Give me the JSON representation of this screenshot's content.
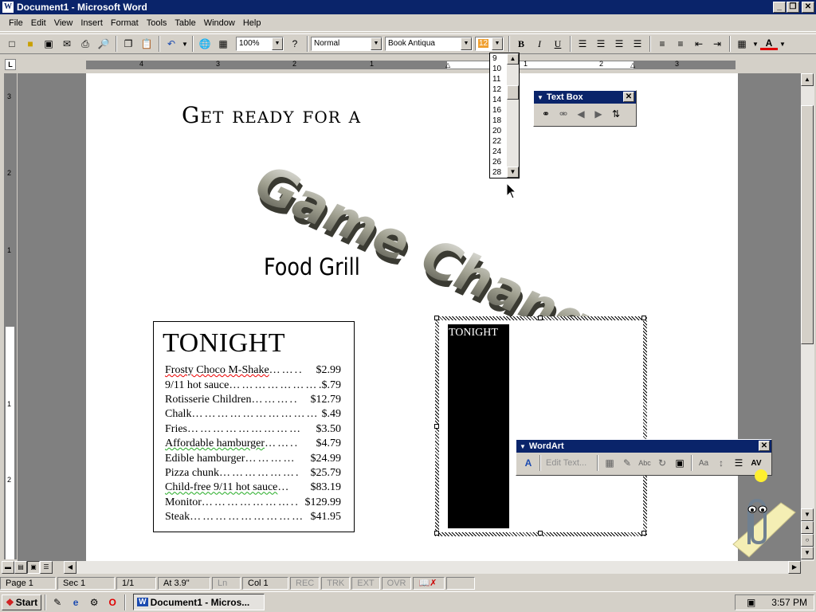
{
  "window": {
    "title": "Document1 - Microsoft Word",
    "app_icon": "W",
    "minimize": "_",
    "restore": "❐",
    "close": "✕"
  },
  "menu": [
    "File",
    "Edit",
    "View",
    "Insert",
    "Format",
    "Tools",
    "Table",
    "Window",
    "Help"
  ],
  "toolbar": {
    "zoom": "100%",
    "style": "Normal",
    "font": "Book Antiqua",
    "font_size": "12",
    "bold": "B",
    "italic": "I",
    "underline": "U",
    "font_color": "A"
  },
  "font_size_list": [
    "9",
    "10",
    "11",
    "12",
    "14",
    "16",
    "18",
    "20",
    "22",
    "24",
    "26",
    "28"
  ],
  "ruler_numbers": [
    "4",
    "3",
    "2",
    "1",
    "1",
    "2",
    "3"
  ],
  "vruler_numbers": [
    "3",
    "2",
    "1",
    "1",
    "2"
  ],
  "textbox_toolbar": {
    "title": "Text Box",
    "close": "✕"
  },
  "wordart_toolbar": {
    "title": "WordArt",
    "edit_text": "Edit Text...",
    "close": "✕",
    "spacing": "AV",
    "same_height": "Aa"
  },
  "document": {
    "heading": "Get ready for a",
    "wordart": "Game Changer!",
    "subtitle": "Food Grill",
    "menu_title": "TONIGHT",
    "items": [
      {
        "name": "Frosty Choco M-Shake",
        "dots": "……..",
        "price": "$2.99"
      },
      {
        "name": "9/11 hot sauce",
        "dots": "……………………",
        "price": "$.79"
      },
      {
        "name": "Rotisserie Children",
        "dots": "………..",
        "price": "$12.79"
      },
      {
        "name": "Chalk",
        "dots": "…………………………",
        "price": "$.49"
      },
      {
        "name": "Fries",
        "dots": "………………………",
        "price": "$3.50"
      },
      {
        "name": "Affordable hamburger",
        "dots": "……..",
        "price": "$4.79"
      },
      {
        "name": "Edible hamburger",
        "dots": "…………",
        "price": "$24.99"
      },
      {
        "name": "Pizza chunk",
        "dots": "……………….",
        "price": "$25.79"
      },
      {
        "name": "Child-free 9/11 hot sauce",
        "dots": "…",
        "price": "$83.19"
      },
      {
        "name": "Monitor",
        "dots": "…………………..",
        "price": "$129.99"
      },
      {
        "name": "Steak",
        "dots": "………………………",
        "price": "$41.95"
      }
    ],
    "textbox_label": "TONIGHT"
  },
  "status": {
    "page": "Page  1",
    "sec": "Sec  1",
    "pages": "1/1",
    "at": "At  3.9\"",
    "ln": "Ln",
    "col": "Col  1",
    "rec": "REC",
    "trk": "TRK",
    "ext": "EXT",
    "ovr": "OVR"
  },
  "taskbar": {
    "start": "Start",
    "task": "Document1 - Micros...",
    "clock": "3:57 PM"
  },
  "colors": {
    "titlebar": "#0a246a",
    "chrome": "#d4d0c8",
    "doc_bg": "#808080"
  }
}
